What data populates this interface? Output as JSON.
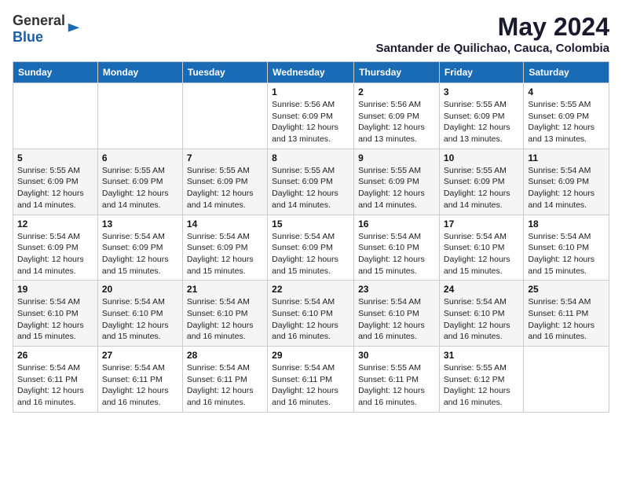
{
  "logo": {
    "text_general": "General",
    "text_blue": "Blue"
  },
  "title": {
    "month_year": "May 2024",
    "location": "Santander de Quilichao, Cauca, Colombia"
  },
  "weekdays": [
    "Sunday",
    "Monday",
    "Tuesday",
    "Wednesday",
    "Thursday",
    "Friday",
    "Saturday"
  ],
  "weeks": [
    [
      {
        "day": "",
        "info": ""
      },
      {
        "day": "",
        "info": ""
      },
      {
        "day": "",
        "info": ""
      },
      {
        "day": "1",
        "info": "Sunrise: 5:56 AM\nSunset: 6:09 PM\nDaylight: 12 hours\nand 13 minutes."
      },
      {
        "day": "2",
        "info": "Sunrise: 5:56 AM\nSunset: 6:09 PM\nDaylight: 12 hours\nand 13 minutes."
      },
      {
        "day": "3",
        "info": "Sunrise: 5:55 AM\nSunset: 6:09 PM\nDaylight: 12 hours\nand 13 minutes."
      },
      {
        "day": "4",
        "info": "Sunrise: 5:55 AM\nSunset: 6:09 PM\nDaylight: 12 hours\nand 13 minutes."
      }
    ],
    [
      {
        "day": "5",
        "info": "Sunrise: 5:55 AM\nSunset: 6:09 PM\nDaylight: 12 hours\nand 14 minutes."
      },
      {
        "day": "6",
        "info": "Sunrise: 5:55 AM\nSunset: 6:09 PM\nDaylight: 12 hours\nand 14 minutes."
      },
      {
        "day": "7",
        "info": "Sunrise: 5:55 AM\nSunset: 6:09 PM\nDaylight: 12 hours\nand 14 minutes."
      },
      {
        "day": "8",
        "info": "Sunrise: 5:55 AM\nSunset: 6:09 PM\nDaylight: 12 hours\nand 14 minutes."
      },
      {
        "day": "9",
        "info": "Sunrise: 5:55 AM\nSunset: 6:09 PM\nDaylight: 12 hours\nand 14 minutes."
      },
      {
        "day": "10",
        "info": "Sunrise: 5:55 AM\nSunset: 6:09 PM\nDaylight: 12 hours\nand 14 minutes."
      },
      {
        "day": "11",
        "info": "Sunrise: 5:54 AM\nSunset: 6:09 PM\nDaylight: 12 hours\nand 14 minutes."
      }
    ],
    [
      {
        "day": "12",
        "info": "Sunrise: 5:54 AM\nSunset: 6:09 PM\nDaylight: 12 hours\nand 14 minutes."
      },
      {
        "day": "13",
        "info": "Sunrise: 5:54 AM\nSunset: 6:09 PM\nDaylight: 12 hours\nand 15 minutes."
      },
      {
        "day": "14",
        "info": "Sunrise: 5:54 AM\nSunset: 6:09 PM\nDaylight: 12 hours\nand 15 minutes."
      },
      {
        "day": "15",
        "info": "Sunrise: 5:54 AM\nSunset: 6:09 PM\nDaylight: 12 hours\nand 15 minutes."
      },
      {
        "day": "16",
        "info": "Sunrise: 5:54 AM\nSunset: 6:10 PM\nDaylight: 12 hours\nand 15 minutes."
      },
      {
        "day": "17",
        "info": "Sunrise: 5:54 AM\nSunset: 6:10 PM\nDaylight: 12 hours\nand 15 minutes."
      },
      {
        "day": "18",
        "info": "Sunrise: 5:54 AM\nSunset: 6:10 PM\nDaylight: 12 hours\nand 15 minutes."
      }
    ],
    [
      {
        "day": "19",
        "info": "Sunrise: 5:54 AM\nSunset: 6:10 PM\nDaylight: 12 hours\nand 15 minutes."
      },
      {
        "day": "20",
        "info": "Sunrise: 5:54 AM\nSunset: 6:10 PM\nDaylight: 12 hours\nand 15 minutes."
      },
      {
        "day": "21",
        "info": "Sunrise: 5:54 AM\nSunset: 6:10 PM\nDaylight: 12 hours\nand 16 minutes."
      },
      {
        "day": "22",
        "info": "Sunrise: 5:54 AM\nSunset: 6:10 PM\nDaylight: 12 hours\nand 16 minutes."
      },
      {
        "day": "23",
        "info": "Sunrise: 5:54 AM\nSunset: 6:10 PM\nDaylight: 12 hours\nand 16 minutes."
      },
      {
        "day": "24",
        "info": "Sunrise: 5:54 AM\nSunset: 6:10 PM\nDaylight: 12 hours\nand 16 minutes."
      },
      {
        "day": "25",
        "info": "Sunrise: 5:54 AM\nSunset: 6:11 PM\nDaylight: 12 hours\nand 16 minutes."
      }
    ],
    [
      {
        "day": "26",
        "info": "Sunrise: 5:54 AM\nSunset: 6:11 PM\nDaylight: 12 hours\nand 16 minutes."
      },
      {
        "day": "27",
        "info": "Sunrise: 5:54 AM\nSunset: 6:11 PM\nDaylight: 12 hours\nand 16 minutes."
      },
      {
        "day": "28",
        "info": "Sunrise: 5:54 AM\nSunset: 6:11 PM\nDaylight: 12 hours\nand 16 minutes."
      },
      {
        "day": "29",
        "info": "Sunrise: 5:54 AM\nSunset: 6:11 PM\nDaylight: 12 hours\nand 16 minutes."
      },
      {
        "day": "30",
        "info": "Sunrise: 5:55 AM\nSunset: 6:11 PM\nDaylight: 12 hours\nand 16 minutes."
      },
      {
        "day": "31",
        "info": "Sunrise: 5:55 AM\nSunset: 6:12 PM\nDaylight: 12 hours\nand 16 minutes."
      },
      {
        "day": "",
        "info": ""
      }
    ]
  ]
}
